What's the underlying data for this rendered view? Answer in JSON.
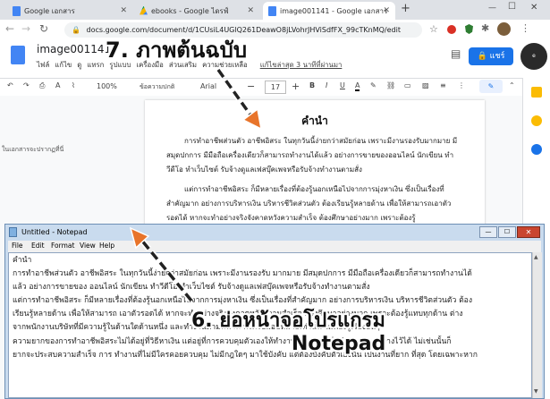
{
  "browser": {
    "tabs": [
      {
        "title": "Google เอกสาร",
        "icon": "docs-icon"
      },
      {
        "title": "ebooks - Google ไดรฟ์",
        "icon": "drive-icon"
      },
      {
        "title": "image001141 - Google เอกสาร",
        "icon": "docs-icon"
      }
    ],
    "new_tab": "+",
    "url": "docs.google.com/document/d/1CUsiL4UGlQ261DeawO8jLVohrJHViSdfFX_99cTKnMQ/edit"
  },
  "doc": {
    "title": "image001141",
    "menu": [
      "ไฟล์",
      "แก้ไข",
      "ดู",
      "แทรก",
      "รูปแบบ",
      "เครื่องมือ",
      "ส่วนเสริม",
      "ความช่วยเหลือ"
    ],
    "last_edit": "แก้ไขล่าสุด 3 นาทีที่ผ่านมา",
    "share_label": "แชร์",
    "zoom": "100%",
    "style": "ข้อความปกติ",
    "font": "Arial",
    "font_size": "17",
    "outline_hint": "ในเอกสารจะปรากฏที่นี่",
    "heading": "คำนำ",
    "paragraphs": [
      "การทำอาชีพส่วนตัว อาชีพอิสระ ในทุกวันนี้ง่ายกว่าสมัยก่อน เพราะมีงานรองรับมากมาย มีสมุดปกการ มีมือถือเครื่องเดียวก็สามารถทำงานได้แล้ว อย่างการขายของออนไลน์ นักเขียน ทำวีดีโอ ทำเว็บไซต์ รับจ้างดูแลเฟสบุ๊คเพจหรือรับจ้างทำงานตามสั่ง",
      "แต่การทำอาชีพอิสระ ก็มีหลายเรื่องที่ต้องรู้นอกเหนือไปจากการมุ่งหาเงิน ซึ่งเป็นเรื่องที่สำคัญมาก อย่างการบริหารเงิน บริหารชีวิตส่วนตัว ต้องเรียนรู้หลายด้าน เพื่อให้สามารถเอาตัวรอดได้ หากจะทำอย่างจริงจังคาดหวังความสำเร็จ ต้องศึกษาอย่างมาก เพราะต้องรู้"
    ]
  },
  "notepad": {
    "title": "Untitled - Notepad",
    "menu": [
      "File",
      "Edit",
      "Format",
      "View",
      "Help"
    ],
    "lines": [
      "คำนำ",
      "การทำอาชีพส่วนตัว อาชีพอิสระ ในทุกวันนี้ง่ายกว่าสมัยก่อน เพราะมีงานรองรับ มากมาย มีสมุดปกการ มีมือถือเครื่องเดียวก็สามารถทำงานได้",
      "แล้ว อย่างการขายของ ออนไลน์ นักเขียน ทำวีดีโอ ทำเว็บไซต์ รับจ้างดูแลเฟสบุ๊คเพจหรือรับจ้างทำงานตามสั่ง",
      "แต่การทำอาชีพอิสระ ก็มีหลายเรื่องที่ต้องรู้นอกเหนือไปจากการมุ่งหาเงิน ซึ่งเป็นเรื่องที่สำคัญมาก อย่างการบริหารเงิน บริหารชีวิตส่วนตัว ต้อง",
      "เรียนรู้หลายด้าน เพื่อให้สามารถ เอาตัวรอดได้ หากจะทำอย่างจริงจังคาดหวังความสำเร็จ ต้องศึกษาอย่างมาก เพราะต้องรู้แทบทุกด้าน ต่าง",
      "จากพนักงานบริษัทที่มีความรู้ในด้านใดด้านหนึ่ง และทำงานตามหน้าที่ ที่ได้รับมอบหมายเท่านั้น ไม่ต้องรู้เรื่องอื่นๆ",
      "ความยากของการทำอาชีพอิสระไม่ได้อยู่ที่วิธีหาเงิน แต่อยู่ที่การควบคุมตัวเองให้ทำงานตามแผนหรือทำตามแผนที่วางไว้ได้ ไม่เช่นนั้นก็",
      "ยากจะประสบความสำเร็จ การ ทำงานที่ไม่มีใครคอยควบคุม ไม่มีกฎใดๆ มาใช้บังคับ แต่ต้องบังคับตัวเองนั้น เป็นงานที่ยาก ที่สุด โดยเฉพาะหาก"
    ]
  },
  "annotations": {
    "step7": "7. ภาพต้นฉบับ",
    "step6": "6. ย่อหน้าจอโปรแกรม",
    "step6_sub": "Notepad"
  },
  "colors": {
    "docs_blue": "#1a73e8",
    "arrow": "#e8742a"
  }
}
